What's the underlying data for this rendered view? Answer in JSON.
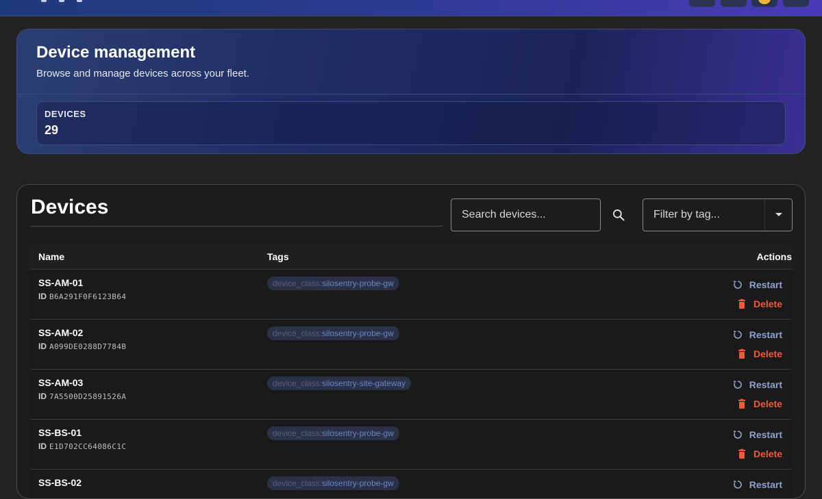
{
  "hero": {
    "title": "Device management",
    "subtitle": "Browse and manage devices across your fleet.",
    "stat_label": "DEVICES",
    "stat_value": "29"
  },
  "devices": {
    "title": "Devices",
    "search_placeholder": "Search devices...",
    "filter_placeholder": "Filter by tag...",
    "columns": {
      "name": "Name",
      "tags": "Tags",
      "actions": "Actions"
    },
    "id_label": "ID",
    "restart_label": "Restart",
    "delete_label": "Delete",
    "rows": [
      {
        "name": "SS-AM-01",
        "id": "B6A291F0F6123B64",
        "tag_key": "device_class:",
        "tag_value": "silosentry-probe-gw"
      },
      {
        "name": "SS-AM-02",
        "id": "A099DE0288D7784B",
        "tag_key": "device_class:",
        "tag_value": "silosentry-probe-gw"
      },
      {
        "name": "SS-AM-03",
        "id": "7A5500D25891526A",
        "tag_key": "device_class:",
        "tag_value": "silosentry-site-gateway"
      },
      {
        "name": "SS-BS-01",
        "id": "E1D702CC64086C1C",
        "tag_key": "device_class:",
        "tag_value": "silosentry-probe-gw"
      },
      {
        "name": "SS-BS-02",
        "id": "",
        "tag_key": "device_class:",
        "tag_value": "silosentry-probe-gw"
      }
    ]
  },
  "colors": {
    "accent": "#4a3ab8",
    "restart": "#8fa2cf",
    "delete": "#ef5a3a",
    "notification": "#f2b33a"
  },
  "icons": {
    "search": "search-icon",
    "dropdown": "caret-down-icon",
    "restart": "restart-icon",
    "delete": "trash-icon"
  }
}
